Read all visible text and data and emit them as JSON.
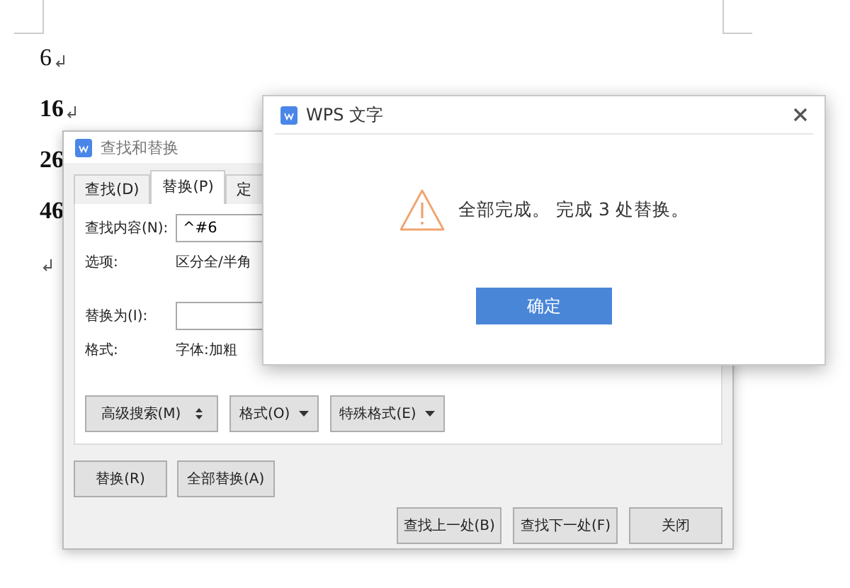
{
  "document": {
    "lines": [
      {
        "kind": "text",
        "text": "6",
        "bold": false,
        "paragraph_mark": true
      },
      {
        "kind": "text",
        "text": "16",
        "bold": true,
        "paragraph_mark": true
      },
      {
        "kind": "text",
        "text": "26",
        "bold": true,
        "paragraph_mark": false
      },
      {
        "kind": "text",
        "text": "46",
        "bold": true,
        "paragraph_mark": false
      },
      {
        "kind": "blank",
        "paragraph_mark": true
      }
    ]
  },
  "find_replace_dialog": {
    "title": "查找和替换",
    "tabs": [
      {
        "label": "查找(D)",
        "selected": false
      },
      {
        "label": "替换(P)",
        "selected": true
      },
      {
        "label": "定",
        "selected": false
      }
    ],
    "fields": [
      {
        "kind": "input",
        "label": "查找内容(N):",
        "value": "^#6"
      },
      {
        "kind": "info",
        "label": "选项:",
        "value": "区分全/半角"
      },
      {
        "kind": "input",
        "label": "替换为(I):"
      },
      {
        "kind": "info",
        "label": "格式:",
        "value": "字体:加粗"
      }
    ],
    "option_buttons": [
      {
        "label": "高级搜索(M)",
        "kind": "expand"
      },
      {
        "label": "格式(O)",
        "kind": "dropdown"
      },
      {
        "label": "特殊格式(E)",
        "kind": "dropdown"
      }
    ],
    "replace_buttons": [
      "替换(R)",
      "全部替换(A)"
    ],
    "footer_buttons": [
      "查找上一处(B)",
      "查找下一处(F)",
      "关闭"
    ]
  },
  "message_box": {
    "title": "WPS 文字",
    "message": "全部完成。 完成 3 处替换。",
    "button": "确定"
  }
}
